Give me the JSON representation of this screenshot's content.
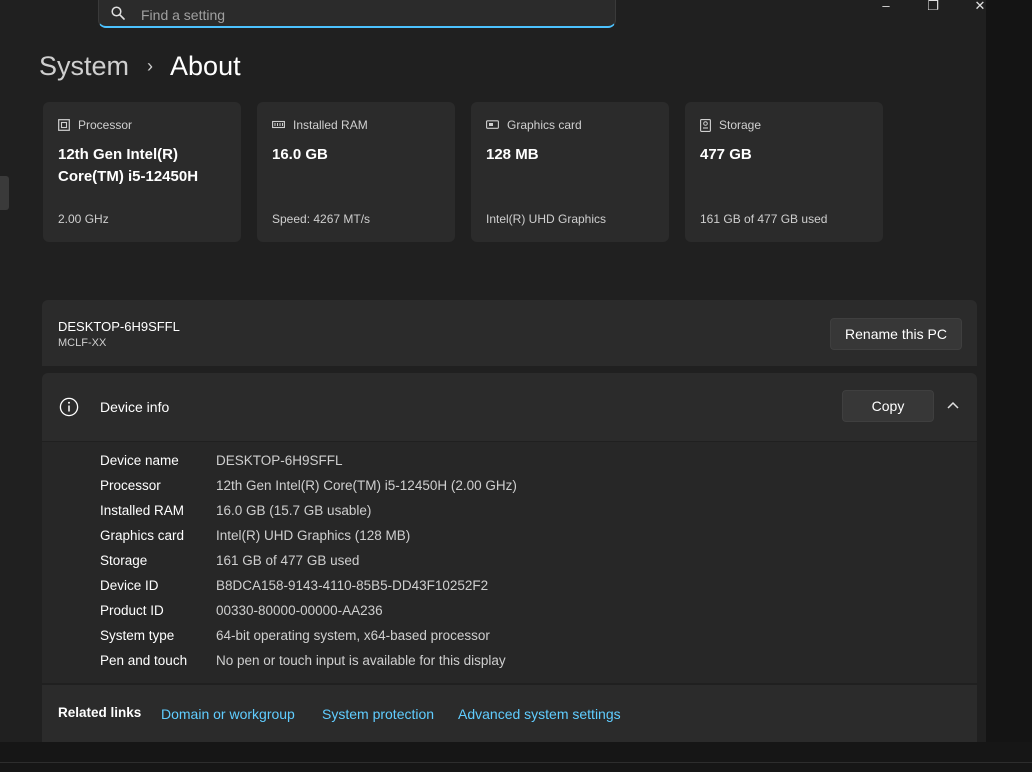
{
  "search": {
    "placeholder": "Find a setting"
  },
  "window_controls": {
    "minimize": "–",
    "maximize": "❐",
    "close": "✕"
  },
  "breadcrumb": {
    "parent": "System",
    "separator": "›",
    "current": "About"
  },
  "specs": [
    {
      "icon": "processor-icon",
      "label": "Processor",
      "value": "12th Gen Intel(R) Core(TM) i5-12450H",
      "sub": "2.00 GHz"
    },
    {
      "icon": "ram-icon",
      "label": "Installed RAM",
      "value": "16.0 GB",
      "sub": "Speed: 4267 MT/s"
    },
    {
      "icon": "graphics-card-icon",
      "label": "Graphics card",
      "value": "128 MB",
      "sub": "Intel(R) UHD Graphics"
    },
    {
      "icon": "storage-icon",
      "label": "Storage",
      "value": "477 GB",
      "sub": "161 GB of 477 GB used"
    }
  ],
  "pc": {
    "name": "DESKTOP-6H9SFFL",
    "model": "MCLF-XX",
    "rename_label": "Rename this PC"
  },
  "device_info": {
    "title": "Device info",
    "copy_label": "Copy",
    "rows": [
      {
        "label": "Device name",
        "value": "DESKTOP-6H9SFFL"
      },
      {
        "label": "Processor",
        "value": "12th Gen Intel(R) Core(TM) i5-12450H (2.00 GHz)"
      },
      {
        "label": "Installed RAM",
        "value": "16.0 GB (15.7 GB usable)"
      },
      {
        "label": "Graphics card",
        "value": "Intel(R) UHD Graphics (128 MB)"
      },
      {
        "label": "Storage",
        "value": "161 GB of 477 GB used"
      },
      {
        "label": "Device ID",
        "value": "B8DCA158-9143-4110-85B5-DD43F10252F2"
      },
      {
        "label": "Product ID",
        "value": "00330-80000-00000-AA236"
      },
      {
        "label": "System type",
        "value": "64-bit operating system, x64-based processor"
      },
      {
        "label": "Pen and touch",
        "value": "No pen or touch input is available for this display"
      }
    ]
  },
  "related_links": {
    "title": "Related links",
    "links": [
      "Domain or workgroup",
      "System protection",
      "Advanced system settings"
    ]
  },
  "colors": {
    "accent": "#4cc2ff",
    "link": "#60cdff",
    "card": "#2b2b2b",
    "background": "#202020"
  }
}
